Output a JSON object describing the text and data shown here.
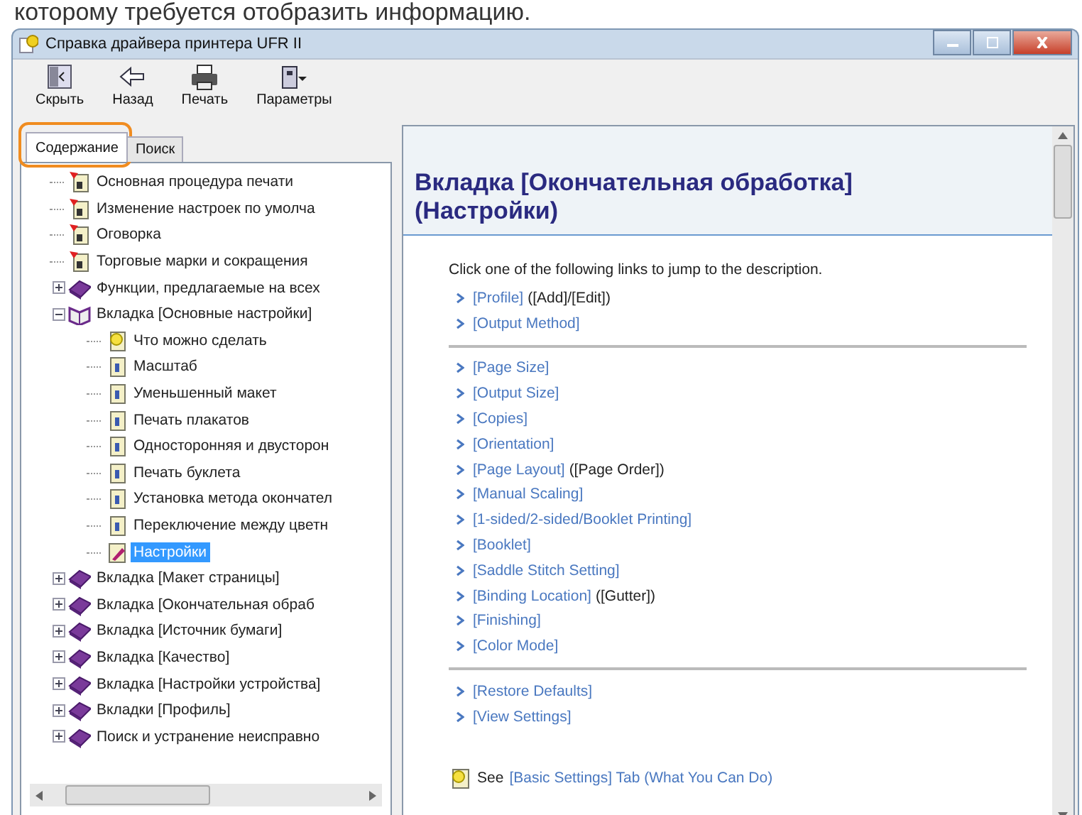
{
  "caption": "которому требуется отобразить информацию.",
  "window": {
    "title": "Справка драйвера принтера UFR II"
  },
  "toolbar": [
    {
      "kind": "hide",
      "label": "Скрыть"
    },
    {
      "kind": "back",
      "label": "Назад"
    },
    {
      "kind": "print",
      "label": "Печать"
    },
    {
      "kind": "options",
      "label": "Параметры"
    }
  ],
  "tabs": [
    {
      "label": "Содержание",
      "selected": true,
      "highlighted": true
    },
    {
      "label": "Поиск",
      "selected": false,
      "highlighted": false
    }
  ],
  "tree": [
    {
      "kind": "page-flag",
      "label": "Основная процедура печати",
      "selected": false
    },
    {
      "kind": "page-flag",
      "label": "Изменение настроек по умолча",
      "selected": false
    },
    {
      "kind": "page-flag",
      "label": "Оговорка",
      "selected": false
    },
    {
      "kind": "page-flag",
      "label": "Торговые марки и сокращения",
      "selected": false
    },
    {
      "kind": "book",
      "label": "Функции, предлагаемые на всех",
      "selected": false,
      "expanded": false
    },
    {
      "kind": "book",
      "label": "Вкладка [Основные настройки]",
      "selected": false,
      "expanded": true,
      "children": [
        {
          "kind": "page-tip",
          "label": "Что можно сделать",
          "selected": false
        },
        {
          "kind": "page",
          "label": "Масштаб",
          "selected": false
        },
        {
          "kind": "page",
          "label": "Уменьшенный макет",
          "selected": false
        },
        {
          "kind": "page",
          "label": "Печать плакатов",
          "selected": false
        },
        {
          "kind": "page",
          "label": "Односторонняя и двусторон",
          "selected": false
        },
        {
          "kind": "page",
          "label": "Печать буклета",
          "selected": false
        },
        {
          "kind": "page",
          "label": "Установка метода окончател",
          "selected": false
        },
        {
          "kind": "page",
          "label": "Переключение между цветн",
          "selected": false
        },
        {
          "kind": "page-edit",
          "label": "Настройки",
          "selected": true
        }
      ]
    },
    {
      "kind": "book",
      "label": "Вкладка [Макет страницы]",
      "selected": false,
      "expanded": false
    },
    {
      "kind": "book",
      "label": "Вкладка [Окончательная обраб",
      "selected": false,
      "expanded": false
    },
    {
      "kind": "book",
      "label": "Вкладка [Источник бумаги]",
      "selected": false,
      "expanded": false
    },
    {
      "kind": "book",
      "label": "Вкладка [Качество]",
      "selected": false,
      "expanded": false
    },
    {
      "kind": "book",
      "label": "Вкладка [Настройки устройства]",
      "selected": false,
      "expanded": false
    },
    {
      "kind": "book",
      "label": "Вкладки [Профиль]",
      "selected": false,
      "expanded": false
    },
    {
      "kind": "book",
      "label": "Поиск и устранение неисправно",
      "selected": false,
      "expanded": false
    }
  ],
  "content": {
    "heading": "Вкладка [Окончательная обработка] (Настройки)",
    "intro": "Click one of the following links to jump to the description.",
    "groups": [
      [
        {
          "link": "[Profile]",
          "note": "([Add]/[Edit])"
        },
        {
          "link": "[Output Method]"
        }
      ],
      [
        {
          "link": "[Page Size]"
        },
        {
          "link": "[Output Size]"
        },
        {
          "link": "[Copies]"
        },
        {
          "link": "[Orientation]"
        },
        {
          "link": "[Page Layout]",
          "note": "([Page Order])"
        },
        {
          "link": "[Manual Scaling]"
        },
        {
          "link": "[1-sided/2-sided/Booklet Printing]"
        },
        {
          "link": "[Booklet]"
        },
        {
          "link": "[Saddle Stitch Setting]"
        },
        {
          "link": "[Binding Location]",
          "note": "([Gutter])"
        },
        {
          "link": "[Finishing]"
        },
        {
          "link": "[Color Mode]"
        }
      ],
      [
        {
          "link": "[Restore Defaults]"
        },
        {
          "link": "[View Settings]"
        }
      ]
    ],
    "footer": {
      "text": "See",
      "link": "[Basic Settings] Tab (What You Can Do)"
    }
  }
}
